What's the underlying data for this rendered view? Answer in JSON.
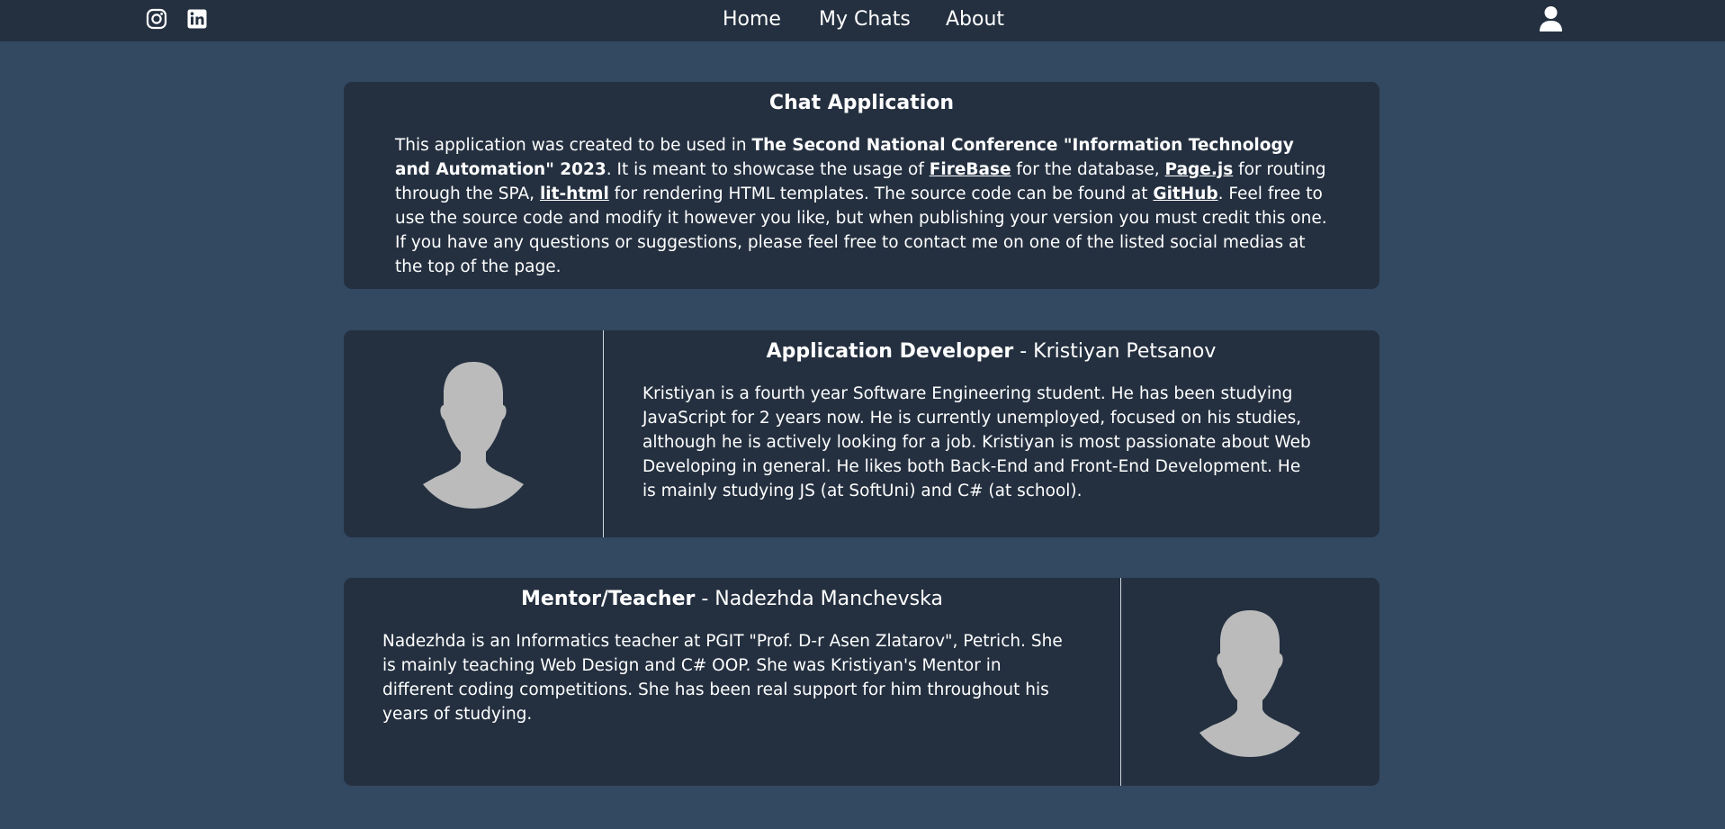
{
  "nav": {
    "links": [
      "Home",
      "My Chats",
      "About"
    ],
    "social_icons": [
      "instagram-icon",
      "linkedin-icon"
    ],
    "user_icon": "user-icon"
  },
  "about_card": {
    "title": "Chat Application",
    "text_1": "This application was created to be used in ",
    "conference": "The Second National Conference \"Information Technology and Automation\" 2023",
    "text_2": ". It is meant to showcase the usage of ",
    "link_firebase": "FireBase",
    "text_3": " for the database, ",
    "link_pagejs": "Page.js",
    "text_4": " for routing through the SPA, ",
    "link_lithtml": "lit-html",
    "text_5": " for rendering HTML templates. The source code can be found at ",
    "link_github": "GitHub",
    "text_6": ". Feel free to use the source code and modify it however you like, but when publishing your version you must credit this one. If you have any questions or suggestions, please feel free to contact me on one of the listed social medias at the top of the page."
  },
  "developer_card": {
    "role": "Application Developer",
    "separator": " - ",
    "name": "Kristiyan Petsanov",
    "bio": "Kristiyan is a fourth year Software Engineering student. He has been studying JavaScript for 2 years now. He is currently unemployed, focused on his studies, although he is actively looking for a job. Kristiyan is most passionate about Web Developing in general. He likes both Back-End and Front-End Development. He is mainly studying JS (at SoftUni) and C# (at school).",
    "avatar_icon": "person-silhouette-icon"
  },
  "mentor_card": {
    "role": "Mentor/Teacher",
    "separator": " - ",
    "name": "Nadezhda Manchevska",
    "bio": "Nadezhda is an Informatics teacher at PGIT \"Prof. D-r Asen Zlatarov\", Petrich. She is mainly teaching Web Design and C# OOP. She was Kristiyan's Mentor in different coding competitions. She has been real support for him throughout his years of studying.",
    "avatar_icon": "person-silhouette-icon"
  },
  "colors": {
    "page_background": "#334861",
    "navbar_background": "#243040",
    "card_background": "#243040",
    "avatar_fill": "#bbbbbb",
    "text": "#ffffff"
  }
}
